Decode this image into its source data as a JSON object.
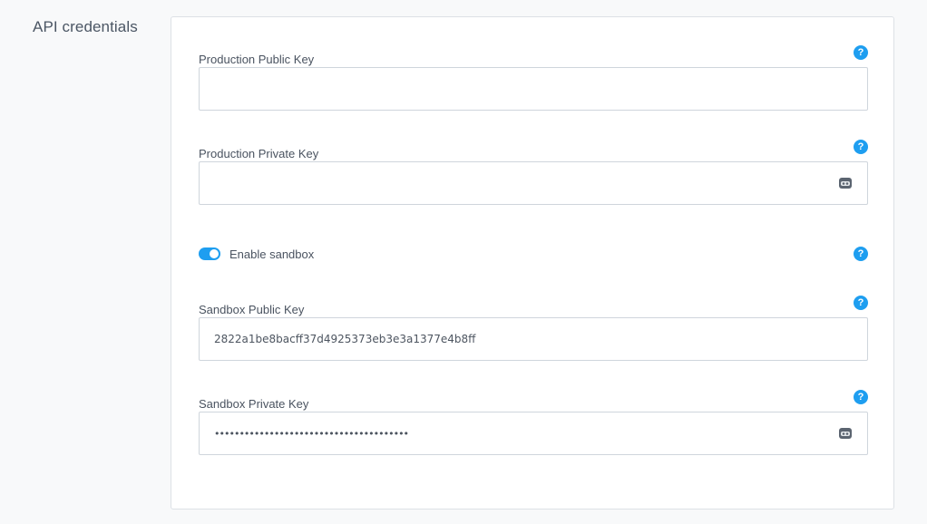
{
  "section": {
    "title": "API credentials"
  },
  "fields": {
    "production_public": {
      "label": "Production Public Key",
      "value": ""
    },
    "production_private": {
      "label": "Production Private Key",
      "value": ""
    },
    "sandbox_public": {
      "label": "Sandbox Public Key",
      "value": "2822a1be8bacff37d4925373eb3e3a1377e4b8ff"
    },
    "sandbox_private": {
      "label": "Sandbox Private Key",
      "value": "•••••••••••••••••••••••••••••••••••••••"
    }
  },
  "sandbox_toggle": {
    "label": "Enable sandbox",
    "enabled": true
  },
  "help": {
    "glyph": "?"
  },
  "colors": {
    "accent": "#1e9ef0",
    "card_bg": "#ffffff",
    "page_bg": "#f8f9fa",
    "border": "#cfd5dc"
  }
}
